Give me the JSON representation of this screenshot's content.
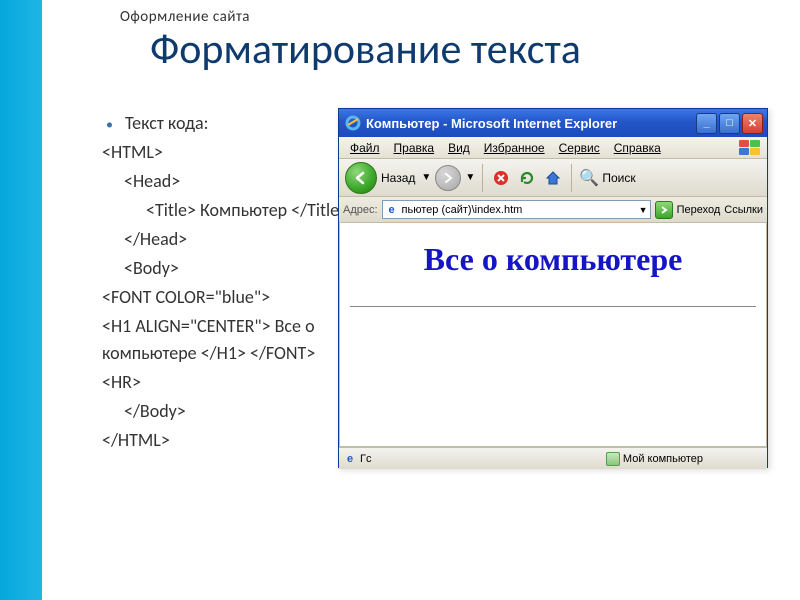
{
  "slide": {
    "pretitle": "Оформление   сайта",
    "title": "Форматирование текста",
    "bullet_label": "Текст кода:",
    "code_lines": [
      "<HTML>",
      "<Head>",
      "<Title> Компьютер </Title>",
      "</Head>",
      "<Body>",
      "<FONT COLOR=\"blue\">",
      "<H1 ALIGN=\"CENTER\"> Все о компьютере </H1> </FONT>",
      "<HR>",
      "</Body>",
      "</HTML>"
    ]
  },
  "ie": {
    "title": "Компьютер - Microsoft Internet Explorer",
    "menus": {
      "file": "Файл",
      "edit": "Правка",
      "view": "Вид",
      "fav": "Избранное",
      "tools": "Сервис",
      "help": "Справка"
    },
    "toolbar": {
      "back": "Назад",
      "search": "Поиск"
    },
    "address": {
      "label": "Адрес:",
      "value": "пьютер (сайт)\\index.htm",
      "go": "Переход",
      "links": "Ссылки"
    },
    "page": {
      "heading": "Все о компьютере"
    },
    "status": {
      "left": "Гс",
      "zone": "Мой компьютер"
    }
  }
}
